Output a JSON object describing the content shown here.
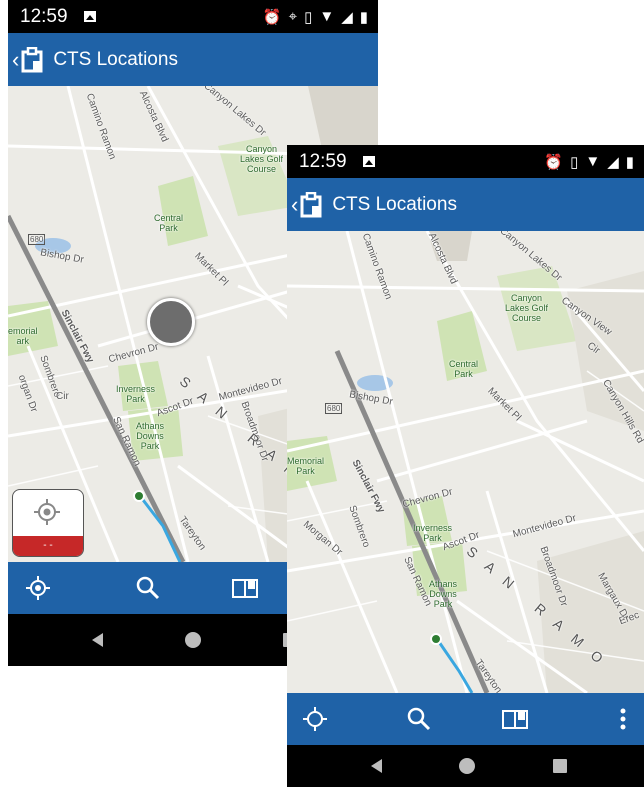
{
  "status_bar": {
    "time": "12:59"
  },
  "app_bar": {
    "title": "CTS Locations"
  },
  "map_labels_back": {
    "camino_ramon": "Camino Ramon",
    "alcosta": "Alcosta Blvd",
    "canyon_lakes_dr": "Canyon Lakes Dr",
    "golf_course": "Canyon\nLakes Golf\nCourse",
    "central_park": "Central\nPark",
    "bishop": "Bishop Dr",
    "market": "Market Pl",
    "hwy": "680",
    "sinclair": "Sinclair Fwy",
    "memorial": "emorial\nark",
    "chevron": "Chevron Dr",
    "morgan": "organ Dr",
    "sombrero": "Sombrero",
    "cir": "Cir",
    "inverness": "Inverness\nPark",
    "ascot": "Ascot Dr",
    "montevideo": "Montevideo Dr",
    "san_ramon": "San Ramon",
    "athans": "Athans\nDowns\nPark",
    "broadmoor": "Broadmoor Dr",
    "city": "SAN RAMO",
    "tareyton": "Tareyton"
  },
  "map_labels_front": {
    "camino_ramon": "Camino Ramon",
    "alcosta": "Alcosta Blvd",
    "canyon_lakes_dr": "Canyon Lakes Dr",
    "golf_course": "Canyon\nLakes Golf\nCourse",
    "canyon_view": "Canyon View",
    "cir": "Cir",
    "central_park": "Central\nPark",
    "bishop": "Bishop Dr",
    "market": "Market Pl",
    "canyon_hills": "Canyon Hills Rd",
    "hwy": "680",
    "sinclair": "Sinclair Fwy",
    "memorial": "Memorial\nPark",
    "chevron": "Chevron Dr",
    "morgan": "Morgan Dr",
    "sombrero": "Sombrero",
    "inverness": "Inverness\nPark",
    "ascot": "Ascot Dr",
    "montevideo": "Montevideo Dr",
    "san_ramon": "San Ramon",
    "athans": "Athans\nDowns\nPark",
    "broadmoor": "Broadmoor Dr",
    "margaux": "Margaux Dr",
    "erec": "Erec",
    "city": "SAN RAMO",
    "tareyton": "Tareyton"
  },
  "location_card": {
    "status": "- -",
    "status_color": "#c62828"
  },
  "colors": {
    "brand_blue": "#1f62a7",
    "map_bg": "#ecebe6",
    "park_green": "#cfe3b4",
    "freeway": "#8a8a8a",
    "route": "#3aa7e0"
  },
  "toolbar_icons": [
    "locate-icon",
    "search-icon",
    "map-book-icon",
    "overflow-menu-icon"
  ],
  "nav_icons": [
    "back-triangle-icon",
    "home-circle-icon",
    "recents-square-icon"
  ]
}
